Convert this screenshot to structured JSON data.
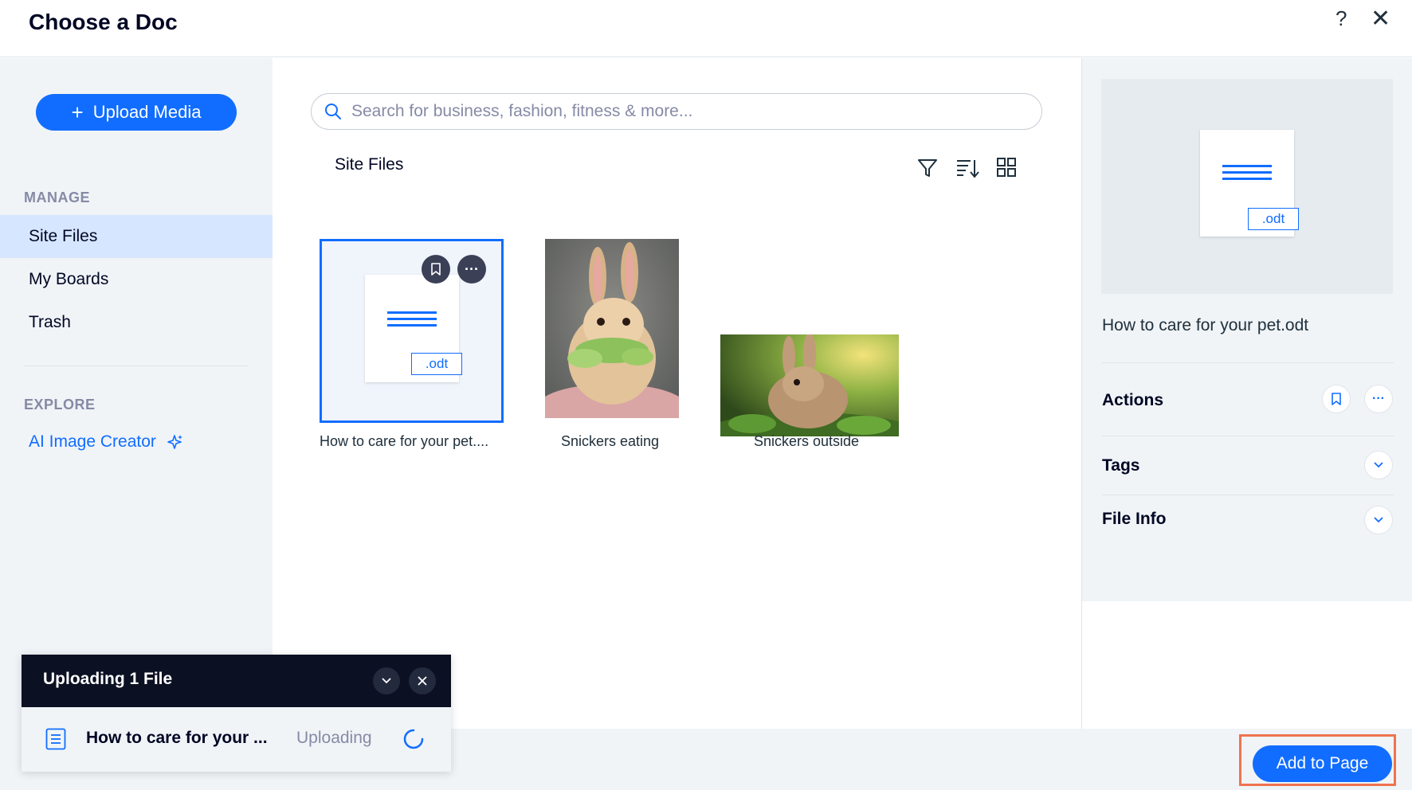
{
  "header": {
    "title": "Choose a Doc",
    "help_label": "?",
    "close_label": "✕"
  },
  "sidebar": {
    "upload_label": "Upload Media",
    "manage_label": "MANAGE",
    "items": [
      {
        "label": "Site Files",
        "active": true
      },
      {
        "label": "My Boards",
        "active": false
      },
      {
        "label": "Trash",
        "active": false
      }
    ],
    "explore_label": "EXPLORE",
    "ai_label": "AI Image Creator"
  },
  "main": {
    "search_placeholder": "Search for business, fashion, fitness & more...",
    "breadcrumb": "Site Files",
    "files": [
      {
        "label": "How to care for your pet....",
        "ext": ".odt",
        "kind": "doc",
        "selected": true
      },
      {
        "label": "Snickers eating",
        "kind": "image"
      },
      {
        "label": "Snickers outside",
        "kind": "image"
      }
    ]
  },
  "details": {
    "ext": ".odt",
    "file_name": "How to care for your pet.odt",
    "actions_label": "Actions",
    "tags_label": "Tags",
    "file_info_label": "File Info"
  },
  "footer": {
    "add_label": "Add to Page"
  },
  "upload_panel": {
    "title": "Uploading 1 File",
    "file_name": "How to care for your ...",
    "status": "Uploading"
  },
  "colors": {
    "accent": "#116dff",
    "highlight": "#f0734f",
    "dark": "#0b1022"
  }
}
